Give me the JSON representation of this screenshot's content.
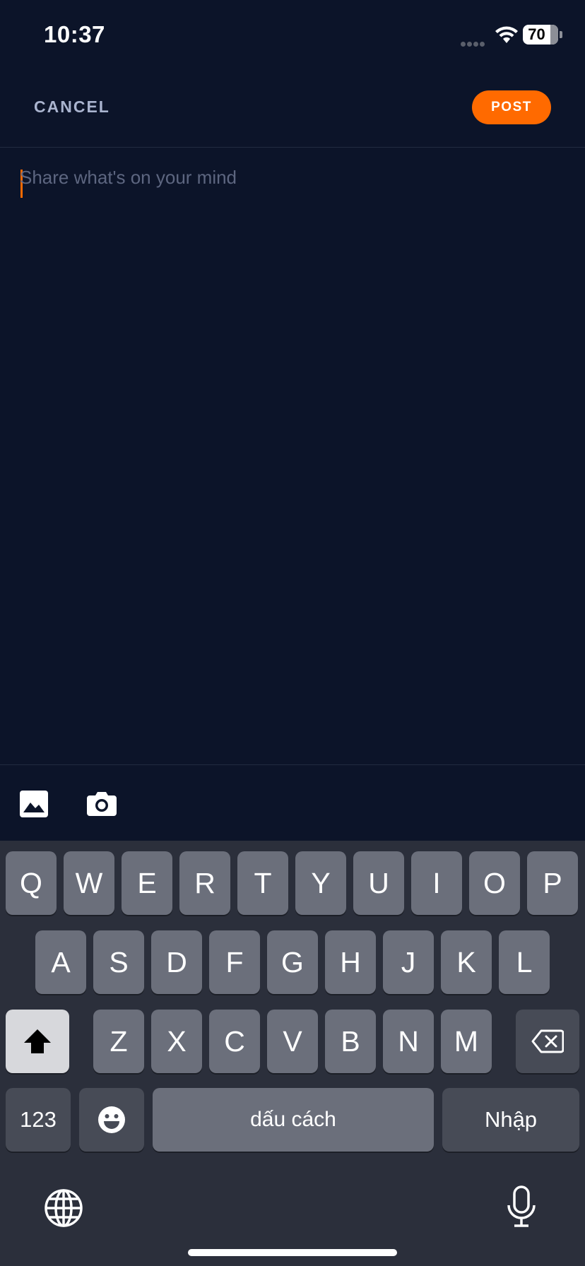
{
  "status_bar": {
    "time": "10:37",
    "battery_level": "70",
    "icons": [
      "signal-icon",
      "wifi-icon",
      "battery-icon"
    ]
  },
  "header": {
    "cancel_label": "CANCEL",
    "post_label": "POST"
  },
  "composer": {
    "value": "",
    "placeholder": "Share what's on your mind"
  },
  "attachments": {
    "icons": [
      "image-icon",
      "camera-icon"
    ]
  },
  "keyboard": {
    "row1": [
      "Q",
      "W",
      "E",
      "R",
      "T",
      "Y",
      "U",
      "I",
      "O",
      "P"
    ],
    "row2": [
      "A",
      "S",
      "D",
      "F",
      "G",
      "H",
      "J",
      "K",
      "L"
    ],
    "row3": [
      "Z",
      "X",
      "C",
      "V",
      "B",
      "N",
      "M"
    ],
    "numbers_label": "123",
    "space_label": "dấu cách",
    "return_label": "Nhập",
    "icons": [
      "shift-icon",
      "delete-icon",
      "emoji-icon",
      "globe-icon",
      "microphone-icon"
    ]
  },
  "colors": {
    "background": "#0c1429",
    "accent": "#ff6a00",
    "cancel_text": "#aab4cf",
    "placeholder": "#5d6680",
    "keyboard_bg": "#2b2f3b",
    "key": "#6b6f7b",
    "key_special": "#474b56"
  }
}
